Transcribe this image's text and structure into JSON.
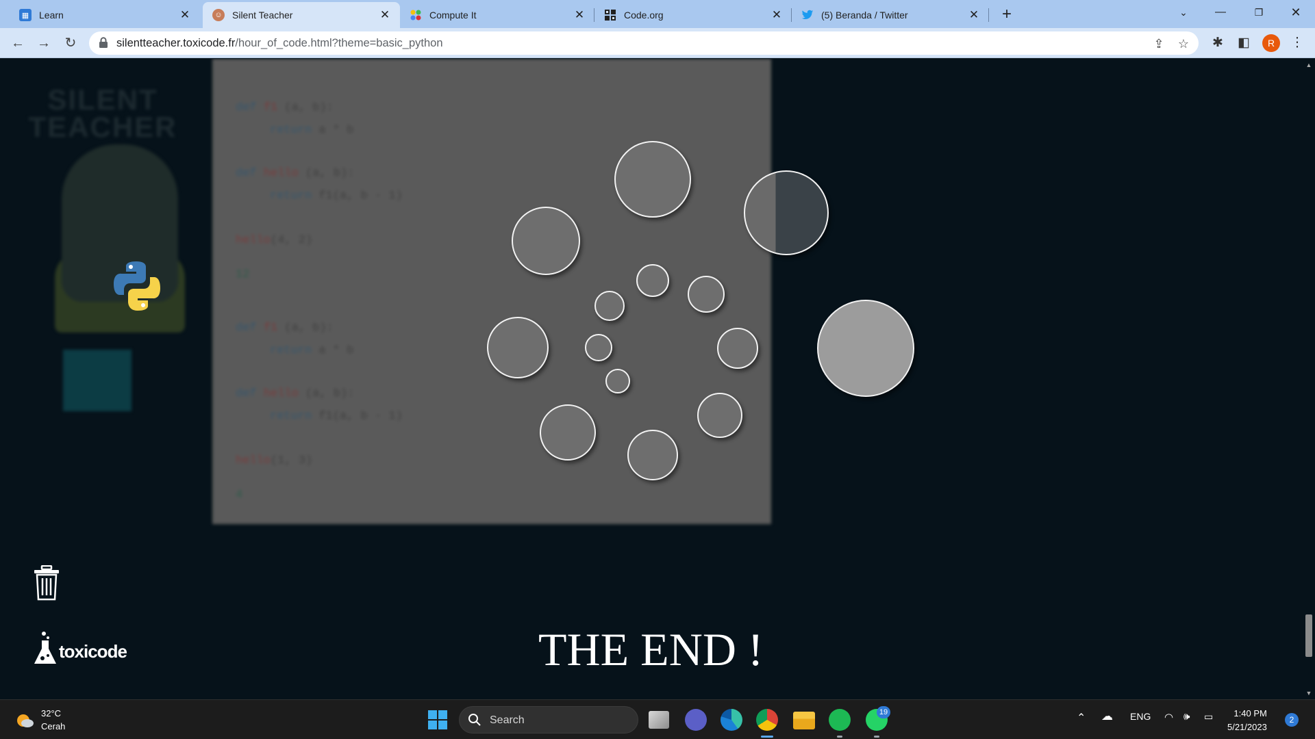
{
  "browser": {
    "tabs": [
      {
        "label": "Learn",
        "icon": "hour-of-code-icon",
        "active": false
      },
      {
        "label": "Silent Teacher",
        "icon": "silent-teacher-icon",
        "active": true
      },
      {
        "label": "Compute It",
        "icon": "compute-it-icon",
        "active": false
      },
      {
        "label": "Code.org",
        "icon": "code-org-icon",
        "active": false
      },
      {
        "label": "(5) Beranda / Twitter",
        "icon": "twitter-icon",
        "active": false
      }
    ],
    "url_host": "silentteacher.toxicode.fr",
    "url_path": "/hour_of_code.html?theme=basic_python",
    "profile_initial": "R"
  },
  "page": {
    "code_lines": [
      {
        "kw": "def",
        "name": "f1",
        "args": "(a, b):"
      },
      {
        "kw": "return",
        "name": "",
        "args": "a * b"
      },
      {
        "kw": "def",
        "name": "hello",
        "args": "(a, b):"
      },
      {
        "kw": "return",
        "name": "",
        "args": "f1(a, b - 1)"
      },
      {
        "kw": "",
        "name": "hello",
        "args": "(4, 2)"
      },
      {
        "kw": "",
        "name": "",
        "args": "12"
      },
      {
        "kw": "def",
        "name": "f1",
        "args": "(a, b):"
      },
      {
        "kw": "return",
        "name": "",
        "args": "a * b"
      },
      {
        "kw": "def",
        "name": "hello",
        "args": "(a, b):"
      },
      {
        "kw": "return",
        "name": "",
        "args": "f1(a, b - 1)"
      },
      {
        "kw": "",
        "name": "hello",
        "args": "(1, 3)"
      },
      {
        "kw": "",
        "name": "",
        "args": "4"
      }
    ],
    "end_text": "THE END !",
    "logo_text": "toxicode",
    "mascot_title": "SILENT TEACHER"
  },
  "taskbar": {
    "weather_temp": "32°C",
    "weather_desc": "Cerah",
    "search_placeholder": "Search",
    "whatsapp_badge": "19",
    "language": "ENG",
    "time": "1:40 PM",
    "date": "5/21/2023",
    "notification_count": "2"
  },
  "colors": {
    "page_background": "#06121a",
    "code_panel": "#5a5a5a",
    "bubble_fill": "#6e6e6e",
    "bubble_light": "#9c9c9c",
    "tab_strip": "#a9c8ef"
  }
}
